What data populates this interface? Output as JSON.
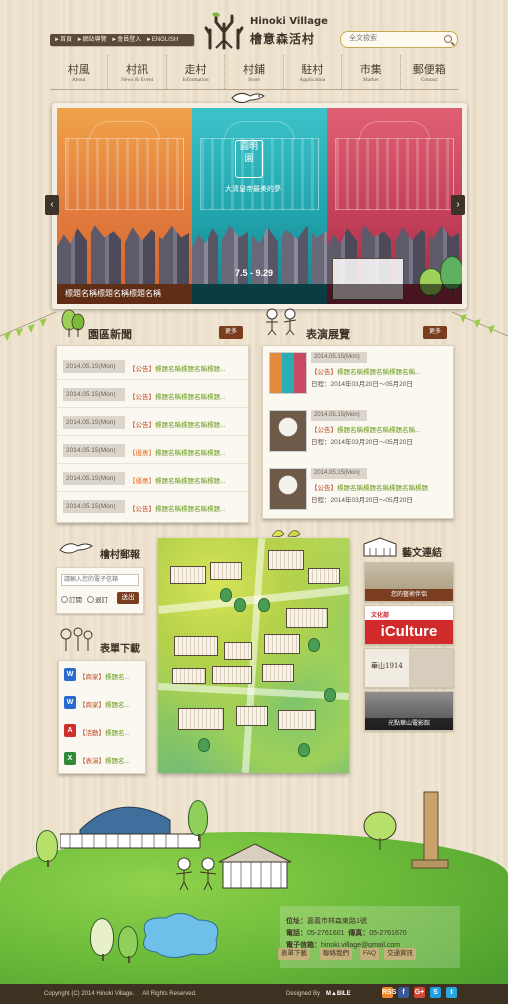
{
  "header": {
    "quick_links": [
      "►首頁",
      "►網站導覽",
      "►會員登入",
      "►ENGLISH"
    ],
    "logo_en": "Hinoki Village",
    "logo_zh": "檜意森活村",
    "search_placeholder": "全文檢索"
  },
  "nav": [
    {
      "zh": "村風",
      "en": "About"
    },
    {
      "zh": "村訊",
      "en": "News & Event"
    },
    {
      "zh": "走村",
      "en": "Information"
    },
    {
      "zh": "村鋪",
      "en": "Store"
    },
    {
      "zh": "駐村",
      "en": "Application"
    },
    {
      "zh": "市集",
      "en": "Market"
    },
    {
      "zh": "郵便箱",
      "en": "Contact"
    }
  ],
  "banner": {
    "seal_text": "圓明園",
    "tagline": "大清皇帝最美的夢",
    "dates": "7.5 - 9.29",
    "caption": "標題名稱標題名稱標題名稱",
    "prev": "‹",
    "next": "›"
  },
  "news": {
    "title": "園區新聞",
    "more": "更多",
    "items": [
      {
        "date": "2014.05.15(Mon)",
        "tag": "【公告】",
        "text": "標題名稱標題名稱標題..."
      },
      {
        "date": "2014.05.15(Mon)",
        "tag": "【公告】",
        "text": "標題名稱標題名稱標題..."
      },
      {
        "date": "2014.05.15(Mon)",
        "tag": "【公告】",
        "text": "標題名稱標題名稱標題..."
      },
      {
        "date": "2014.05.15(Mon)",
        "tag": "【優惠】",
        "text": "標題名稱標題名稱標題..."
      },
      {
        "date": "2014.05.15(Mon)",
        "tag": "【優惠】",
        "text": "標題名稱標題名稱標題..."
      },
      {
        "date": "2014.05.15(Mon)",
        "tag": "【公告】",
        "text": "標題名稱標題名稱標題..."
      }
    ]
  },
  "shows": {
    "title": "表演展覽",
    "more": "更多",
    "items": [
      {
        "date": "2014.05.15(Mon)",
        "tag": "【公告】",
        "text": "標題名稱標題名稱標題名稱...",
        "period": "日程：2014年03月20日～05月20日"
      },
      {
        "date": "2014.05.15(Mon)",
        "tag": "【公告】",
        "text": "標題名稱標題名稱標題名稱...",
        "period": "日程：2014年03月20日～05月20日"
      },
      {
        "date": "2014.05.15(Mon)",
        "tag": "【公告】",
        "text": "標題名稱標題名稱標題名稱標題",
        "period": "日程：2014年03月20日～05月20日"
      }
    ]
  },
  "epaper": {
    "title": "檜村郵報",
    "placeholder": "請輸入您的電子信箱",
    "subscribe": "訂閱",
    "unsubscribe": "退訂",
    "submit": "送出"
  },
  "forms": {
    "title": "表單下載",
    "items": [
      {
        "icon": "W",
        "color": "#2a6bd1",
        "cat": "【商家】",
        "name": "標題名..."
      },
      {
        "icon": "W",
        "color": "#2a6bd1",
        "cat": "【商家】",
        "name": "標題名..."
      },
      {
        "icon": "A",
        "color": "#d0302a",
        "cat": "【活動】",
        "name": "標題名..."
      },
      {
        "icon": "X",
        "color": "#2f8a3a",
        "cat": "【表演】",
        "name": "標題名..."
      }
    ]
  },
  "links": {
    "title": "藝文連結",
    "banner1_text": "您的藝術伴侶",
    "banner2_brand": "文化部",
    "banner2_main": "iCulture",
    "banner3_text": "華山1914",
    "banner4_text": "光點華山電影館"
  },
  "footer": {
    "address_label": "位址：",
    "address": "嘉義市林森東路1號",
    "phone_label": "電話：",
    "phone": "05-2761601",
    "fax_label": "傳真：",
    "fax": "05-2761670",
    "email_label": "電子信箱：",
    "email": "hinoki.village@gmail.com",
    "buttons": [
      "表單下載",
      "聯絡我們",
      "FAQ",
      "交通資訊"
    ],
    "copyright": "Copyright (C) 2014 Hinoki Village.     All Rights Reserved.",
    "designed_by": "Designed By",
    "designer": "M▲BILE",
    "social": [
      "RSS",
      "f",
      "G+",
      "S",
      "t"
    ]
  }
}
